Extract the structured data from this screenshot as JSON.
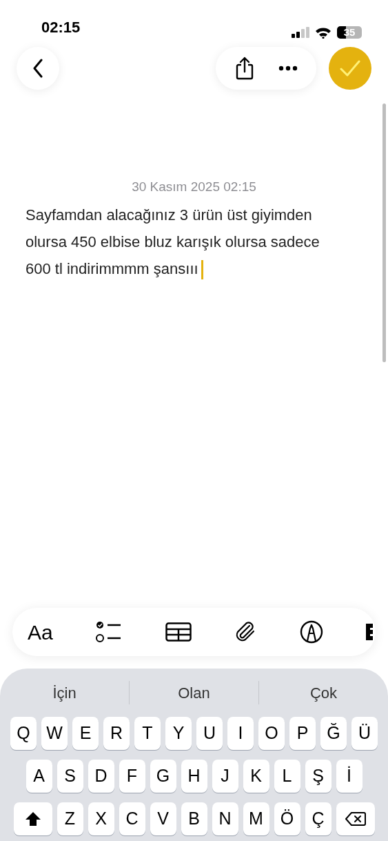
{
  "status_bar": {
    "time": "02:15",
    "battery": "35"
  },
  "note": {
    "date": "30 Kasım 2025 02:15",
    "body": "Sayfamdan alacağınız 3 ürün üst giyimden olursa 450 elbise bluz karışık olursa sadece 600 tl indirimmmm şansııı"
  },
  "toolbar": {
    "format_label": "Aa"
  },
  "keyboard": {
    "suggestions": [
      "İçin",
      "Olan",
      "Çok"
    ],
    "rows": [
      [
        {
          "kind": "letter",
          "label": "Q"
        },
        {
          "kind": "letter",
          "label": "W"
        },
        {
          "kind": "letter",
          "label": "E"
        },
        {
          "kind": "letter",
          "label": "R"
        },
        {
          "kind": "letter",
          "label": "T"
        },
        {
          "kind": "letter",
          "label": "Y"
        },
        {
          "kind": "letter",
          "label": "U"
        },
        {
          "kind": "letter",
          "label": "I"
        },
        {
          "kind": "letter",
          "label": "O"
        },
        {
          "kind": "letter",
          "label": "P"
        },
        {
          "kind": "letter",
          "label": "Ğ"
        },
        {
          "kind": "letter",
          "label": "Ü"
        }
      ],
      [
        {
          "kind": "letter",
          "label": "A"
        },
        {
          "kind": "letter",
          "label": "S"
        },
        {
          "kind": "letter",
          "label": "D"
        },
        {
          "kind": "letter",
          "label": "F"
        },
        {
          "kind": "letter",
          "label": "G"
        },
        {
          "kind": "letter",
          "label": "H"
        },
        {
          "kind": "letter",
          "label": "J"
        },
        {
          "kind": "letter",
          "label": "K"
        },
        {
          "kind": "letter",
          "label": "L"
        },
        {
          "kind": "letter",
          "label": "Ş"
        },
        {
          "kind": "letter",
          "label": "İ"
        }
      ],
      [
        {
          "kind": "shift"
        },
        {
          "kind": "letter",
          "label": "Z"
        },
        {
          "kind": "letter",
          "label": "X"
        },
        {
          "kind": "letter",
          "label": "C"
        },
        {
          "kind": "letter",
          "label": "V"
        },
        {
          "kind": "letter",
          "label": "B"
        },
        {
          "kind": "letter",
          "label": "N"
        },
        {
          "kind": "letter",
          "label": "M"
        },
        {
          "kind": "letter",
          "label": "Ö"
        },
        {
          "kind": "letter",
          "label": "Ç"
        },
        {
          "kind": "delete"
        }
      ]
    ]
  }
}
